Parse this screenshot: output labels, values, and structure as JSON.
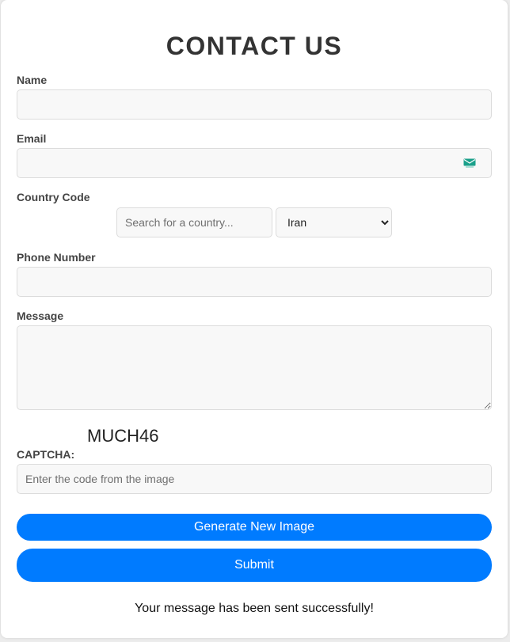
{
  "form": {
    "title": "CONTACT US",
    "name": {
      "label": "Name",
      "value": "",
      "placeholder": ""
    },
    "email": {
      "label": "Email",
      "value": "",
      "placeholder": "",
      "icon": "email-icon"
    },
    "country_code": {
      "label": "Country Code",
      "search_placeholder": "Search for a country...",
      "selected": "Iran",
      "options": [
        "Iran"
      ]
    },
    "phone": {
      "label": "Phone Number",
      "value": "",
      "placeholder": ""
    },
    "message": {
      "label": "Message",
      "value": "",
      "placeholder": ""
    },
    "captcha": {
      "label": "CAPTCHA:",
      "code": "MUCH46",
      "placeholder": "Enter the code from the image"
    },
    "generate_button": "Generate New Image",
    "submit_button": "Submit",
    "success_message": "Your message has been sent successfully!"
  },
  "colors": {
    "primary": "#007bff",
    "title": "#333333",
    "label": "#444444",
    "field_bg": "#f8f8f8",
    "email_icon": "#1aa08a"
  }
}
